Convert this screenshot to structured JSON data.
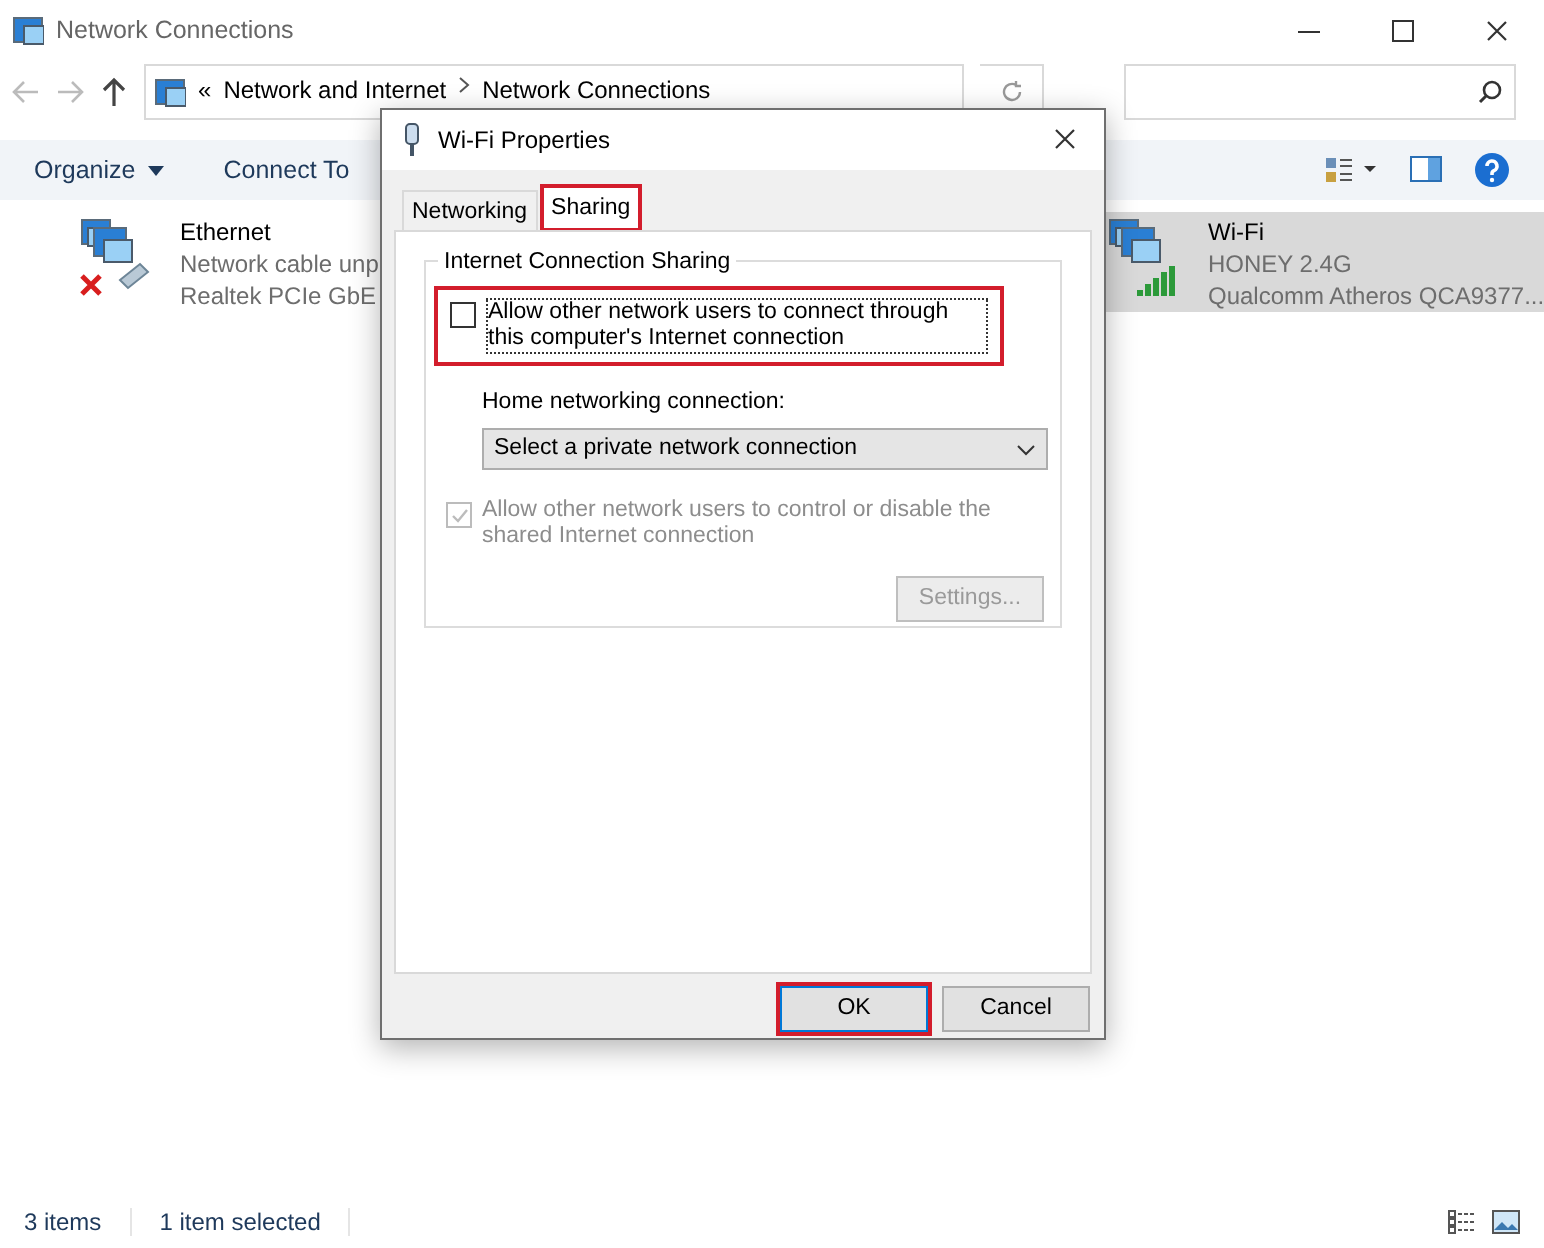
{
  "window": {
    "title": "Network Connections"
  },
  "address": {
    "overflow": "«",
    "crumbs": [
      "Network and Internet",
      "Network Connections"
    ]
  },
  "toolbar": {
    "items": [
      {
        "label": "Organize",
        "dropdown": true
      },
      {
        "label": "Connect To",
        "dropdown": false
      }
    ]
  },
  "connections": [
    {
      "name": "Ethernet",
      "status": "Network cable unp",
      "device": "Realtek PCIe GbE",
      "kind": "wired",
      "disconnected": true,
      "selected": false
    },
    {
      "name": "Wi-Fi",
      "status": "HONEY 2.4G",
      "device": "Qualcomm Atheros QCA9377...",
      "kind": "wireless",
      "disconnected": false,
      "selected": true
    }
  ],
  "status_bar": {
    "count": "3 items",
    "selection": "1 item selected"
  },
  "dialog": {
    "title": "Wi-Fi Properties",
    "tabs": [
      {
        "label": "Networking",
        "selected": false,
        "highlighted": false
      },
      {
        "label": "Sharing",
        "selected": true,
        "highlighted": true
      }
    ],
    "group": {
      "title": "Internet Connection Sharing",
      "allow_connect": {
        "label": "Allow other network users to connect through this computer's Internet connection",
        "checked": false,
        "disabled": false,
        "highlighted": true
      },
      "home_label": "Home networking connection:",
      "home_select": {
        "value": "Select a private network connection"
      },
      "allow_control": {
        "label": "Allow other network users to control or disable the shared Internet connection",
        "checked": true,
        "disabled": true
      },
      "settings_button": {
        "label": "Settings...",
        "disabled": true
      }
    },
    "buttons": [
      {
        "label": "OK",
        "highlighted": true
      },
      {
        "label": "Cancel",
        "highlighted": false
      }
    ]
  }
}
